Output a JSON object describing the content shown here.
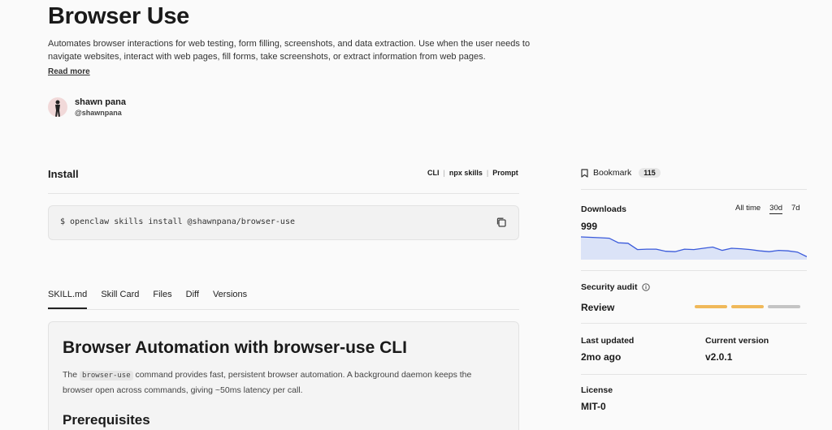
{
  "skill": {
    "title": "Browser Use",
    "description": "Automates browser interactions for web testing, form filling, screenshots, and data extraction. Use when the user needs to navigate websites, interact with web pages, fill forms, take screenshots, or extract information from web pages.",
    "read_more": "Read more"
  },
  "author": {
    "name": "shawn pana",
    "handle": "@shawnpana"
  },
  "install": {
    "heading": "Install",
    "modes": [
      "CLI",
      "npx skills",
      "Prompt"
    ],
    "command": "$ openclaw skills install @shawnpana/browser-use"
  },
  "tabs": [
    "SKILL.md",
    "Skill Card",
    "Files",
    "Diff",
    "Versions"
  ],
  "skill_md": {
    "h1": "Browser Automation with browser-use CLI",
    "p_before": "The ",
    "p_code": "browser-use",
    "p_after": " command provides fast, persistent browser automation. A background daemon keeps the browser open across commands, giving ~50ms latency per call.",
    "h2": "Prerequisites"
  },
  "sidebar": {
    "bookmark_label": "Bookmark",
    "bookmark_count": "115",
    "downloads_label": "Downloads",
    "ranges": [
      "All time",
      "30d",
      "7d"
    ],
    "downloads_value": "999",
    "security_label": "Security audit",
    "security_value": "Review",
    "security_bar_colors": [
      "#f0b95a",
      "#f0b95a",
      "#c4c4c4"
    ],
    "last_updated_label": "Last updated",
    "last_updated_value": "2mo ago",
    "current_version_label": "Current version",
    "current_version_value": "v2.0.1",
    "license_label": "License",
    "license_value": "MIT-0"
  },
  "downloads_chart": {
    "type": "area",
    "values": [
      100,
      98,
      96,
      94,
      72,
      70,
      40,
      42,
      42,
      32,
      30,
      42,
      40,
      46,
      52,
      36,
      46,
      44,
      40,
      34,
      30,
      36,
      34,
      28,
      6
    ],
    "color": "#3b5bdb",
    "fill": "#dbe3f7"
  }
}
